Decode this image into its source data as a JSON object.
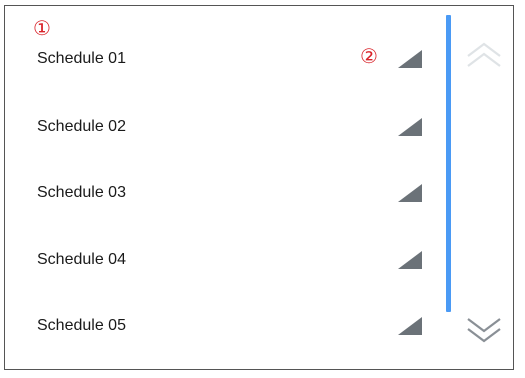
{
  "annotations": {
    "marker_1": "①",
    "marker_2": "②"
  },
  "schedules": [
    {
      "label": "Schedule 01"
    },
    {
      "label": "Schedule 02"
    },
    {
      "label": "Schedule 03"
    },
    {
      "label": "Schedule 04"
    },
    {
      "label": "Schedule 05"
    }
  ],
  "icons": {
    "row_indicator": "corner-triangle-icon",
    "scroll_up": "double-chevron-up-icon",
    "scroll_down": "double-chevron-down-icon"
  },
  "colors": {
    "annotation": "#d9232a",
    "scrollbar": "#4a9af5",
    "indicator": "#6b7278",
    "scroll_up_disabled": "#dfe3e6",
    "scroll_down_enabled": "#8a9096"
  }
}
